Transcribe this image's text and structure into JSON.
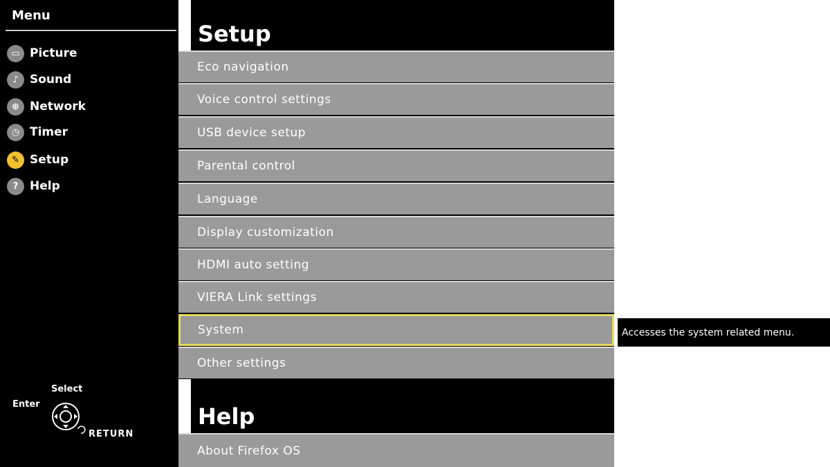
{
  "sidebar": {
    "title": "Menu",
    "items": [
      {
        "label": "Picture",
        "icon": "picture-icon",
        "glyph": "▭",
        "active": false
      },
      {
        "label": "Sound",
        "icon": "music-note-icon",
        "glyph": "♪",
        "active": false
      },
      {
        "label": "Network",
        "icon": "globe-icon",
        "glyph": "⊕",
        "active": false
      },
      {
        "label": "Timer",
        "icon": "clock-icon",
        "glyph": "◷",
        "active": false
      },
      {
        "label": "Setup",
        "icon": "wrench-icon",
        "glyph": "✎",
        "active": true
      },
      {
        "label": "Help",
        "icon": "question-icon",
        "glyph": "?",
        "active": false
      }
    ]
  },
  "remote_hint": {
    "select": "Select",
    "enter": "Enter",
    "return": "RETURN"
  },
  "setup": {
    "title": "Setup",
    "items": [
      "Eco navigation",
      "Voice control settings",
      "USB device setup",
      "Parental control",
      "Language",
      "Display customization",
      "HDMI auto setting",
      "VIERA Link settings",
      "System",
      "Other settings"
    ],
    "selected_index": 8
  },
  "help": {
    "title": "Help",
    "items": [
      "About Firefox OS"
    ]
  },
  "tooltip": "Accesses the system related menu.",
  "colors": {
    "background": "#000000",
    "row": "#9a9a9a",
    "selection": "#e8da5a",
    "active_icon": "#f2c12e"
  }
}
